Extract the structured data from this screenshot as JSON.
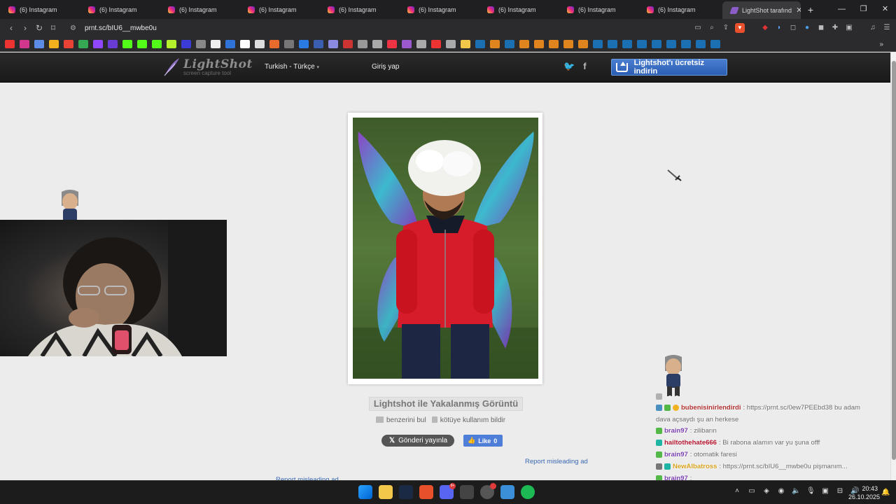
{
  "browser": {
    "tabs": [
      {
        "label": "(6) Instagram"
      },
      {
        "label": "(6) Instagram"
      },
      {
        "label": "(6) Instagram"
      },
      {
        "label": "(6) Instagram"
      },
      {
        "label": "(6) Instagram"
      },
      {
        "label": "(6) Instagram"
      },
      {
        "label": "(6) Instagram"
      },
      {
        "label": "(6) Instagram"
      },
      {
        "label": "(6) Instagram"
      }
    ],
    "active_tab": {
      "label": "LightShot tarafınd"
    },
    "url": "prnt.sc/bIU6__mwbe0u"
  },
  "lightshot": {
    "logo_name": "LightShot",
    "logo_sub": "screen capture tool",
    "language": "Turkish - Türkçe",
    "login": "Giriş yap",
    "download": "Lightshot'ı ücretsiz indirin",
    "caption": "Lightshot ile Yakalanmış Görüntü",
    "find_similar": "benzerini bul",
    "report_abuse": "kötüye kullanım bildir",
    "tweet": "Gönderi yayınla",
    "like": "Like",
    "like_count": "0",
    "report_ad": "Report misleading ad"
  },
  "chat": {
    "messages": [
      {
        "user": "bubenisinirlendirdi",
        "user_color": "#b03030",
        "text": ": https://prnt.sc/0ew7PEEbd38 bu adam"
      },
      {
        "user": "",
        "user_color": "#555555",
        "text": "dava açsaydı şu an herkese"
      },
      {
        "user": "brain97",
        "user_color": "#7b3fb0",
        "text": ": zilibarın"
      },
      {
        "user": "hailtothehate666",
        "user_color": "#b3122c",
        "text": ": Bi rabona alamın var yu şuna offf"
      },
      {
        "user": "brain97",
        "user_color": "#7b3fb0",
        "text": ": otomatik faresi"
      },
      {
        "user": "NewAlbatross",
        "user_color": "#d8a21a",
        "text": ": https://prnt.sc/bIU6__mwbe0u pişmanım..."
      },
      {
        "user": "brain97",
        "user_color": "#7b3fb0",
        "text": ":"
      }
    ]
  },
  "taskbar": {
    "discord_badge": "9+",
    "time": "20:43",
    "date": "26.10.2025"
  }
}
